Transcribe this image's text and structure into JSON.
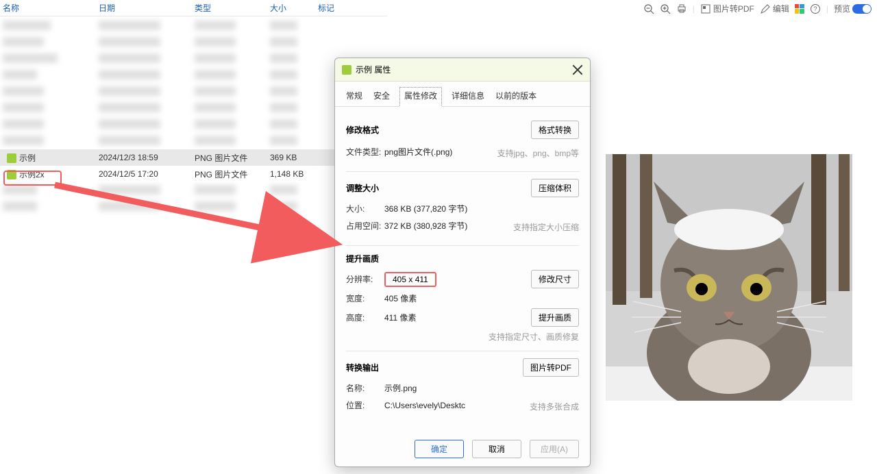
{
  "file_list": {
    "headers": {
      "name": "名称",
      "date": "日期",
      "type": "类型",
      "size": "大小",
      "tag": "标记"
    },
    "rows": [
      {
        "name": "示例",
        "date": "2024/12/3 18:59",
        "type": "PNG 图片文件",
        "size": "369 KB"
      },
      {
        "name": "示例2x",
        "date": "2024/12/5 17:20",
        "type": "PNG 图片文件",
        "size": "1,148 KB"
      }
    ]
  },
  "toolbar": {
    "pdf_label": "图片转PDF",
    "edit_label": "编辑",
    "preview_label": "预览"
  },
  "dialog": {
    "title": "示例 属性",
    "tabs": {
      "general": "常规",
      "security": "安全",
      "attrmod": "属性修改",
      "details": "详细信息",
      "prev": "以前的版本"
    },
    "format": {
      "section_title": "修改格式",
      "convert_btn": "格式转换",
      "filetype_label": "文件类型:",
      "filetype_value": "png图片文件(.png)",
      "hint": "支持jpg、png、bmp等"
    },
    "resize": {
      "section_title": "调整大小",
      "compress_btn": "压缩体积",
      "size_label": "大小:",
      "size_value": "368 KB (377,820 字节)",
      "disk_label": "占用空间:",
      "disk_value": "372 KB (380,928 字节)",
      "hint": "支持指定大小压缩"
    },
    "quality": {
      "section_title": "提升画质",
      "modify_btn": "修改尺寸",
      "enhance_btn": "提升画质",
      "res_label": "分辨率:",
      "res_value": "405 x 411",
      "width_label": "宽度:",
      "width_value": "405 像素",
      "height_label": "高度:",
      "height_value": "411 像素",
      "hint": "支持指定尺寸、画质修复"
    },
    "output": {
      "section_title": "转换输出",
      "pdf_btn": "图片转PDF",
      "name_label": "名称:",
      "name_value": "示例.png",
      "loc_label": "位置:",
      "loc_value": "C:\\Users\\evely\\Desktc",
      "hint": "支持多张合成"
    },
    "footer": {
      "ok": "确定",
      "cancel": "取消",
      "apply": "应用(A)"
    }
  }
}
